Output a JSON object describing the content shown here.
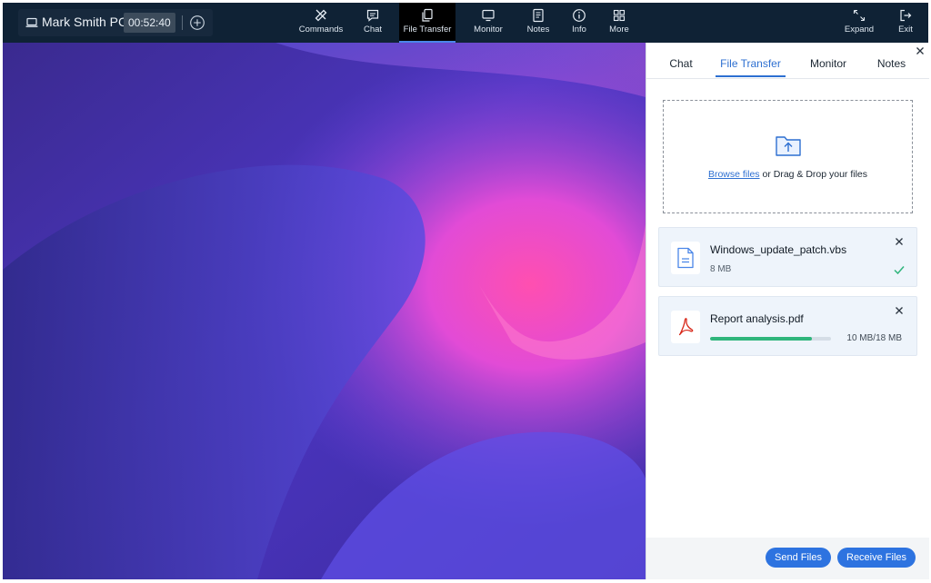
{
  "session": {
    "device_name": "Mark Smith PC",
    "timer": "00:52:40"
  },
  "toolbar": {
    "items": [
      {
        "label": "Commands",
        "icon": "tools-icon"
      },
      {
        "label": "Chat",
        "icon": "chat-icon"
      },
      {
        "label": "File Transfer",
        "icon": "file-transfer-icon",
        "active": true
      },
      {
        "label": "Monitor",
        "icon": "monitor-icon"
      },
      {
        "label": "Notes",
        "icon": "notes-icon"
      },
      {
        "label": "Info",
        "icon": "info-icon"
      },
      {
        "label": "More",
        "icon": "grid-icon"
      }
    ],
    "expand_label": "Expand",
    "exit_label": "Exit"
  },
  "panel": {
    "tabs": [
      "Chat",
      "File Transfer",
      "Monitor",
      "Notes"
    ],
    "active_tab": "File Transfer",
    "dropzone": {
      "browse_label": "Browse files",
      "drop_text": " or Drag & Drop your files"
    },
    "files": [
      {
        "name": "Windows_update_patch.vbs",
        "size": "8 MB",
        "status": "complete",
        "icon": "document-icon"
      },
      {
        "name": "Report analysis.pdf",
        "progress_text": "10 MB/18 MB",
        "progress": 0.84,
        "status": "in-progress",
        "icon": "pdf-icon"
      }
    ],
    "send_label": "Send Files",
    "receive_label": "Receive Files"
  },
  "colors": {
    "accent": "#2d6fd1",
    "topbar": "#0f2235",
    "progress": "#2fb57c"
  }
}
